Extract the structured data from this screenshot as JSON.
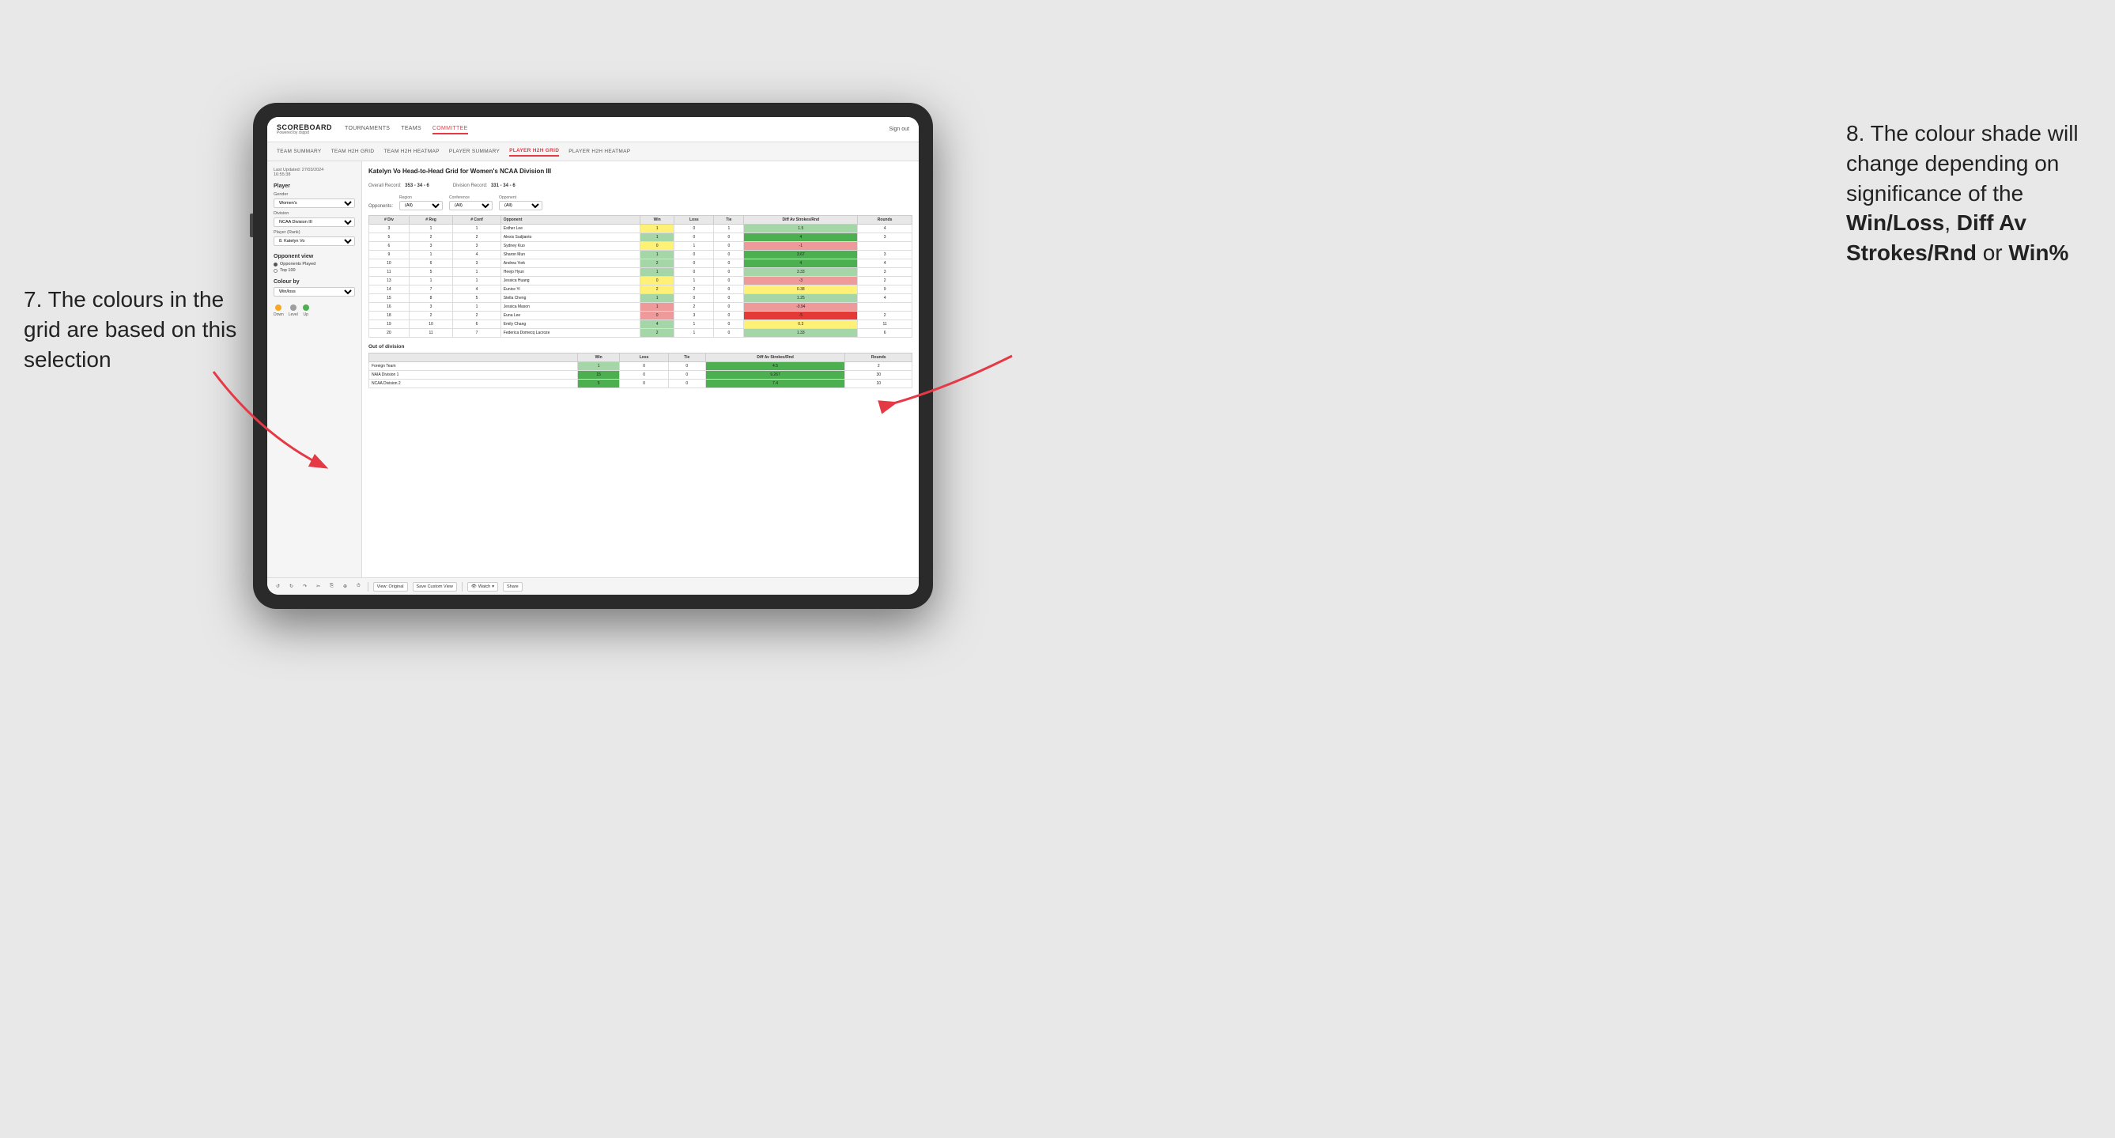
{
  "annotations": {
    "left_title": "7. The colours in the grid are based on this selection",
    "right_title": "8. The colour shade will change depending on significance of the",
    "right_bold1": "Win/Loss",
    "right_comma": ", ",
    "right_bold2": "Diff Av Strokes/Rnd",
    "right_or": " or",
    "right_bold3": "Win%"
  },
  "nav": {
    "logo": "SCOREBOARD",
    "logo_sub": "Powered by clippd",
    "items": [
      "TOURNAMENTS",
      "TEAMS",
      "COMMITTEE"
    ],
    "active": "COMMITTEE",
    "sign_out": "Sign out"
  },
  "sub_nav": {
    "items": [
      "TEAM SUMMARY",
      "TEAM H2H GRID",
      "TEAM H2H HEATMAP",
      "PLAYER SUMMARY",
      "PLAYER H2H GRID",
      "PLAYER H2H HEATMAP"
    ],
    "active": "PLAYER H2H GRID"
  },
  "left_panel": {
    "last_updated_label": "Last Updated: 27/03/2024",
    "last_updated_time": "16:55:38",
    "player_section": "Player",
    "gender_label": "Gender",
    "gender_value": "Women's",
    "division_label": "Division",
    "division_value": "NCAA Division III",
    "player_rank_label": "Player (Rank)",
    "player_rank_value": "8. Katelyn Vo",
    "opponent_view": "Opponent view",
    "opponents_played": "Opponents Played",
    "top_100": "Top 100",
    "colour_by": "Colour by",
    "colour_by_value": "Win/loss",
    "legend_down": "Down",
    "legend_level": "Level",
    "legend_up": "Up"
  },
  "grid": {
    "title": "Katelyn Vo Head-to-Head Grid for Women's NCAA Division III",
    "overall_label": "Overall Record:",
    "overall_value": "353 - 34 - 6",
    "division_label": "Division Record:",
    "division_value": "331 - 34 - 6",
    "opponents_label": "Opponents:",
    "region_label": "Region",
    "conference_label": "Conference",
    "opponent_label": "Opponent",
    "filter_all": "(All)",
    "columns": {
      "div": "# Div",
      "reg": "# Reg",
      "conf": "# Conf",
      "opponent": "Opponent",
      "win": "Win",
      "loss": "Loss",
      "tie": "Tie",
      "diff_av": "Diff Av Strokes/Rnd",
      "rounds": "Rounds"
    },
    "rows": [
      {
        "div": 3,
        "reg": 1,
        "conf": 1,
        "opponent": "Esther Lee",
        "win": 1,
        "loss": 0,
        "tie": 1,
        "diff_av": 1.5,
        "rounds": 4,
        "win_color": "yellow",
        "diff_color": "green_light"
      },
      {
        "div": 5,
        "reg": 2,
        "conf": 2,
        "opponent": "Alexis Sudjianto",
        "win": 1,
        "loss": 0,
        "tie": 0,
        "diff_av": 4.0,
        "rounds": 3,
        "win_color": "green_light",
        "diff_color": "green_dark"
      },
      {
        "div": 6,
        "reg": 3,
        "conf": 3,
        "opponent": "Sydney Kuo",
        "win": 0,
        "loss": 1,
        "tie": 0,
        "diff_av": -1.0,
        "rounds": "",
        "win_color": "yellow",
        "diff_color": "red_light"
      },
      {
        "div": 9,
        "reg": 1,
        "conf": 4,
        "opponent": "Sharon Mun",
        "win": 1,
        "loss": 0,
        "tie": 0,
        "diff_av": 3.67,
        "rounds": 3,
        "win_color": "green_light",
        "diff_color": "green_dark"
      },
      {
        "div": 10,
        "reg": 6,
        "conf": 3,
        "opponent": "Andrea York",
        "win": 2,
        "loss": 0,
        "tie": 0,
        "diff_av": 4.0,
        "rounds": 4,
        "win_color": "green_light",
        "diff_color": "green_dark"
      },
      {
        "div": 11,
        "reg": 5,
        "conf": 1,
        "opponent": "Heejo Hyun",
        "win": 1,
        "loss": 0,
        "tie": 0,
        "diff_av": 3.33,
        "rounds": 3,
        "win_color": "green_light",
        "diff_color": "green_light"
      },
      {
        "div": 13,
        "reg": 1,
        "conf": 1,
        "opponent": "Jessica Huang",
        "win": 0,
        "loss": 1,
        "tie": 0,
        "diff_av": -3.0,
        "rounds": 2,
        "win_color": "yellow",
        "diff_color": "red_light"
      },
      {
        "div": 14,
        "reg": 7,
        "conf": 4,
        "opponent": "Eunice Yi",
        "win": 2,
        "loss": 2,
        "tie": 0,
        "diff_av": 0.38,
        "rounds": 9,
        "win_color": "yellow",
        "diff_color": "yellow"
      },
      {
        "div": 15,
        "reg": 8,
        "conf": 5,
        "opponent": "Stella Cheng",
        "win": 1,
        "loss": 0,
        "tie": 0,
        "diff_av": 1.25,
        "rounds": 4,
        "win_color": "green_light",
        "diff_color": "green_light"
      },
      {
        "div": 16,
        "reg": 3,
        "conf": 1,
        "opponent": "Jessica Mason",
        "win": 1,
        "loss": 2,
        "tie": 0,
        "diff_av": -0.94,
        "rounds": "",
        "win_color": "red_light",
        "diff_color": "red_light"
      },
      {
        "div": 18,
        "reg": 2,
        "conf": 2,
        "opponent": "Euna Lee",
        "win": 0,
        "loss": 3,
        "tie": 0,
        "diff_av": -5.0,
        "rounds": 2,
        "win_color": "red_light",
        "diff_color": "red_dark"
      },
      {
        "div": 19,
        "reg": 10,
        "conf": 6,
        "opponent": "Emily Chang",
        "win": 4,
        "loss": 1,
        "tie": 0,
        "diff_av": 0.3,
        "rounds": 11,
        "win_color": "green_light",
        "diff_color": "yellow"
      },
      {
        "div": 20,
        "reg": 11,
        "conf": 7,
        "opponent": "Federica Domecq Lacroze",
        "win": 2,
        "loss": 1,
        "tie": 0,
        "diff_av": 1.33,
        "rounds": 6,
        "win_color": "green_light",
        "diff_color": "green_light"
      }
    ],
    "out_of_division": "Out of division",
    "ood_rows": [
      {
        "label": "Foreign Team",
        "win": 1,
        "loss": 0,
        "tie": 0,
        "diff_av": 4.5,
        "rounds": 2,
        "win_color": "green_light",
        "diff_color": "green_dark"
      },
      {
        "label": "NAIA Division 1",
        "win": 15,
        "loss": 0,
        "tie": 0,
        "diff_av": 9.267,
        "rounds": 30,
        "win_color": "green_dark",
        "diff_color": "green_dark"
      },
      {
        "label": "NCAA Division 2",
        "win": 5,
        "loss": 0,
        "tie": 0,
        "diff_av": 7.4,
        "rounds": 10,
        "win_color": "green_dark",
        "diff_color": "green_dark"
      }
    ]
  },
  "toolbar": {
    "view_original": "View: Original",
    "save_custom": "Save Custom View",
    "watch": "Watch",
    "share": "Share"
  }
}
